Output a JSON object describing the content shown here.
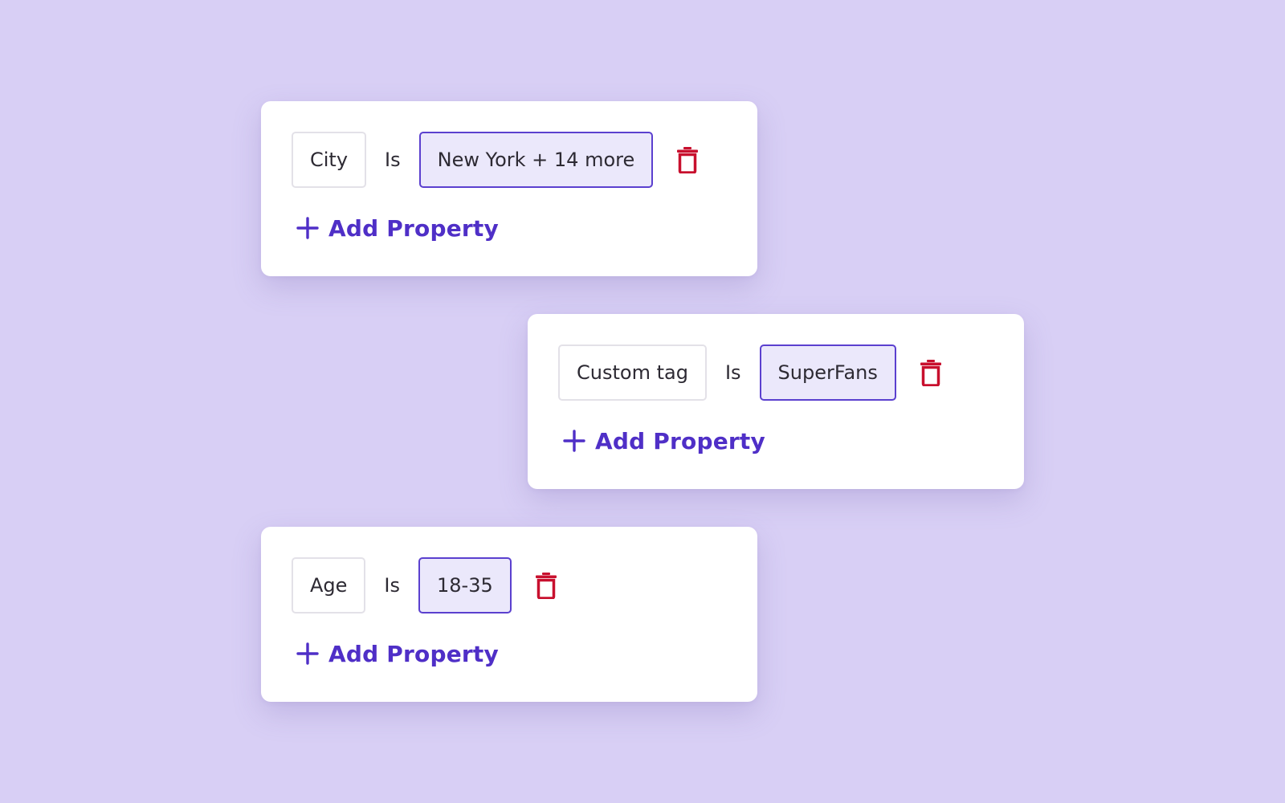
{
  "colors": {
    "background": "#d8cff5",
    "accent": "#4f2fc7",
    "value_border": "#5b40cf",
    "value_fill": "#ebe8fb",
    "delete": "#c8102e"
  },
  "filters": [
    {
      "property": "City",
      "operator": "Is",
      "value": "New York + 14 more",
      "delete_icon": "trash-icon",
      "add_label": "Add Property",
      "add_icon": "plus-icon"
    },
    {
      "property": "Custom tag",
      "operator": "Is",
      "value": "SuperFans",
      "delete_icon": "trash-icon",
      "add_label": "Add Property",
      "add_icon": "plus-icon"
    },
    {
      "property": "Age",
      "operator": "Is",
      "value": "18-35",
      "delete_icon": "trash-icon",
      "add_label": "Add Property",
      "add_icon": "plus-icon"
    }
  ]
}
